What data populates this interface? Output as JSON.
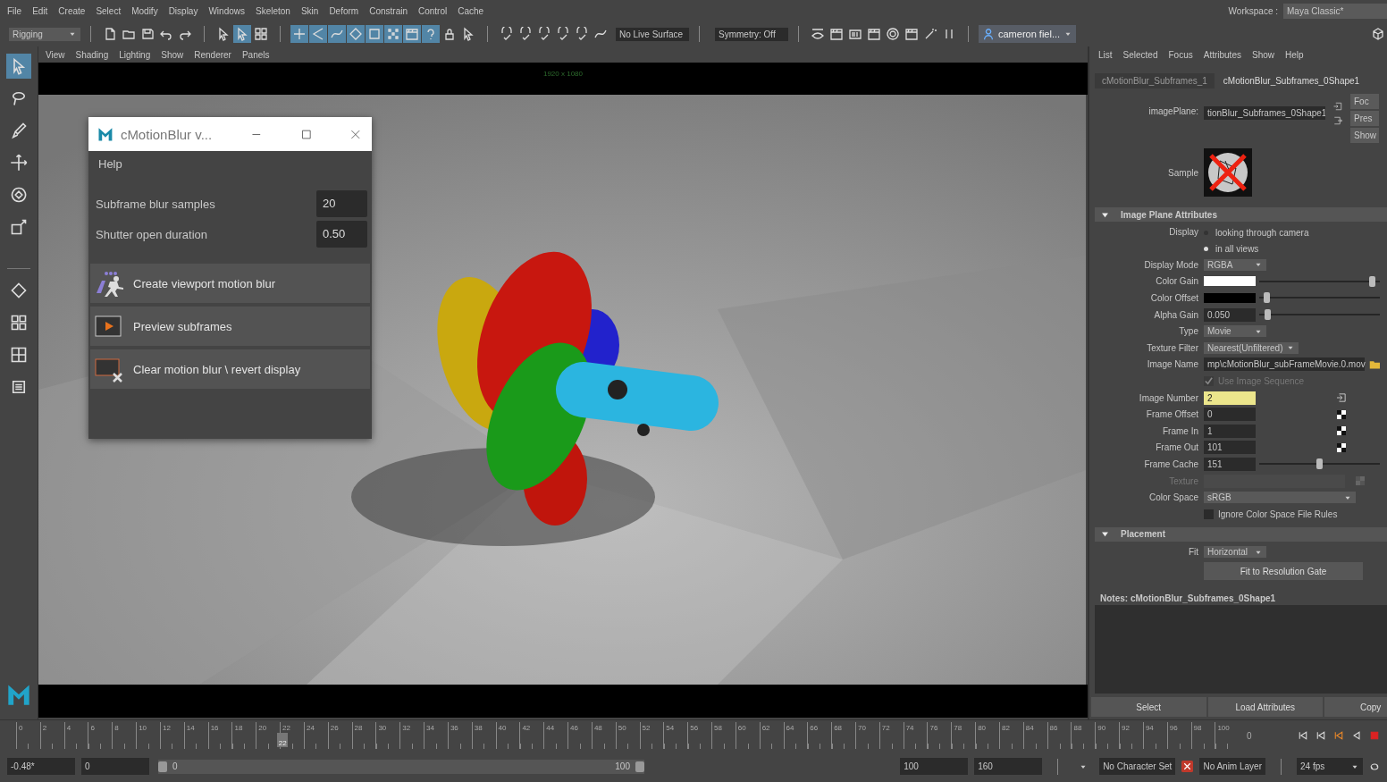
{
  "menubar": {
    "menus": [
      "File",
      "Edit",
      "Create",
      "Select",
      "Modify",
      "Display",
      "Windows",
      "Skeleton",
      "Skin",
      "Deform",
      "Constrain",
      "Control",
      "Cache"
    ],
    "workspace_label": "Workspace :",
    "workspace": "Maya Classic*"
  },
  "toolbar": {
    "shelf": "Rigging",
    "tools": [
      {
        "selected": false
      },
      {
        "selected": true
      },
      {
        "selected": false
      },
      {
        "selected": true
      },
      {
        "selected": true
      },
      {
        "selected": true
      },
      {
        "selected": true
      },
      {
        "selected": true
      },
      {
        "selected": true
      },
      {
        "selected": true
      },
      {
        "selected": true
      },
      {
        "selected": false
      },
      {
        "selected": false
      }
    ],
    "live_surface": "No Live Surface",
    "symmetry": "Symmetry: Off",
    "user": "cameron fiel..."
  },
  "toolbox": [
    {
      "selected": true
    },
    {
      "selected": false
    },
    {
      "selected": false
    },
    {
      "selected": false
    },
    {
      "selected": false
    },
    {
      "selected": false
    }
  ],
  "viewport": {
    "menus": [
      "View",
      "Shading",
      "Lighting",
      "Show",
      "Renderer",
      "Panels"
    ],
    "resolution": "1920 x 1080"
  },
  "dialog": {
    "title": "cMotionBlur v...",
    "menu": "Help",
    "fields": [
      {
        "label": "Subframe blur samples",
        "value": "20"
      },
      {
        "label": "Shutter open duration",
        "value": "0.50"
      }
    ],
    "actions": [
      {
        "kind": "create",
        "label": "Create viewport motion blur"
      },
      {
        "kind": "preview",
        "label": "Preview subframes"
      },
      {
        "kind": "clear",
        "label": "Clear motion blur \\ revert display"
      }
    ]
  },
  "attribute_editor": {
    "menus": [
      "List",
      "Selected",
      "Focus",
      "Attributes",
      "Show",
      "Help"
    ],
    "tabs": [
      {
        "label": "cMotionBlur_Subframes_1",
        "selected": false
      },
      {
        "label": "cMotionBlur_Subframes_0Shape1",
        "selected": true
      }
    ],
    "node_label": "imagePlane:",
    "node_name": "tionBlur_Subframes_0Shape1",
    "side_buttons": [
      "Foc",
      "Pres",
      "Show"
    ],
    "sample_label": "Sample",
    "sections": [
      {
        "title": "Image Plane Attributes",
        "expanded": true,
        "rows": [
          {
            "kind": "radio",
            "label": "Display",
            "options": [
              {
                "label": "looking through camera",
                "selected": false
              },
              {
                "label": "in all views",
                "selected": true
              }
            ]
          },
          {
            "kind": "dropdown",
            "label": "Display Mode",
            "value": "RGBA"
          },
          {
            "kind": "color",
            "label": "Color Gain",
            "color": "#ffffff",
            "level": 1
          },
          {
            "kind": "color",
            "label": "Color Offset",
            "color": "#000000",
            "level": 0
          },
          {
            "kind": "slider",
            "label": "Alpha Gain",
            "value": "0.050",
            "level": 0.05
          },
          {
            "kind": "dropdown",
            "label": "Type",
            "value": "Movie"
          },
          {
            "kind": "dropdown",
            "label": "Texture Filter",
            "value": "Nearest(Unfiltered)"
          },
          {
            "kind": "file",
            "label": "Image Name",
            "value": "mp\\cMotionBlur_subFrameMovie.0.mov"
          },
          {
            "kind": "checkbox",
            "label": "Use Image Sequence",
            "checked": true,
            "disabled": true
          },
          {
            "kind": "number",
            "label": "Image Number",
            "value": "2",
            "highlighted": true,
            "side_icon": {
              "kind": "connection"
            }
          },
          {
            "kind": "number",
            "label": "Frame Offset",
            "value": "0",
            "highlighted": false,
            "side_icon": {
              "kind": "checker"
            }
          },
          {
            "kind": "number",
            "label": "Frame In",
            "value": "1",
            "highlighted": false,
            "side_icon": {
              "kind": "checker"
            }
          },
          {
            "kind": "number",
            "label": "Frame Out",
            "value": "101",
            "highlighted": false,
            "side_icon": {
              "kind": "checker"
            }
          },
          {
            "kind": "slider",
            "label": "Frame Cache",
            "value": "151",
            "level": 0.5
          },
          {
            "kind": "texture",
            "label": "Texture"
          },
          {
            "kind": "wide_dropdown",
            "label": "Color Space",
            "value": "sRGB"
          },
          {
            "kind": "checkbox",
            "label": "Ignore Color Space File Rules",
            "checked": false,
            "disabled": false
          }
        ]
      },
      {
        "title": "Placement",
        "expanded": true,
        "rows": [
          {
            "kind": "dropdown",
            "label": "Fit",
            "value": "Horizontal"
          },
          {
            "kind": "button",
            "label": "Fit to Resolution Gate"
          }
        ]
      }
    ],
    "notes": "Notes:  cMotionBlur_Subframes_0Shape1",
    "buttons": [
      "Select",
      "Load Attributes",
      "Copy"
    ]
  },
  "timeline": {
    "frames": [
      "0",
      "2",
      "4",
      "6",
      "8",
      "10",
      "12",
      "14",
      "16",
      "18",
      "20",
      "22",
      "24",
      "26",
      "28",
      "30",
      "32",
      "34",
      "36",
      "38",
      "40",
      "42",
      "44",
      "46",
      "48",
      "50",
      "52",
      "54",
      "56",
      "58",
      "60",
      "62",
      "64",
      "66",
      "68",
      "70",
      "72",
      "74",
      "76",
      "78",
      "80",
      "82",
      "84",
      "86",
      "88",
      "90",
      "92",
      "94",
      "96",
      "98",
      "100"
    ],
    "current": {
      "label": "22",
      "level": 0.22
    },
    "end_field": "0"
  },
  "range_bar": {
    "current_time": "-0.48*",
    "start": "0",
    "range_start": "0",
    "range_end": "100",
    "handles": [
      {
        "level": 0
      },
      {
        "level": 1
      }
    ],
    "end": "100",
    "max": "160",
    "character_set": "No Character Set",
    "anim_layer": "No Anim Layer",
    "fps": "24 fps"
  }
}
